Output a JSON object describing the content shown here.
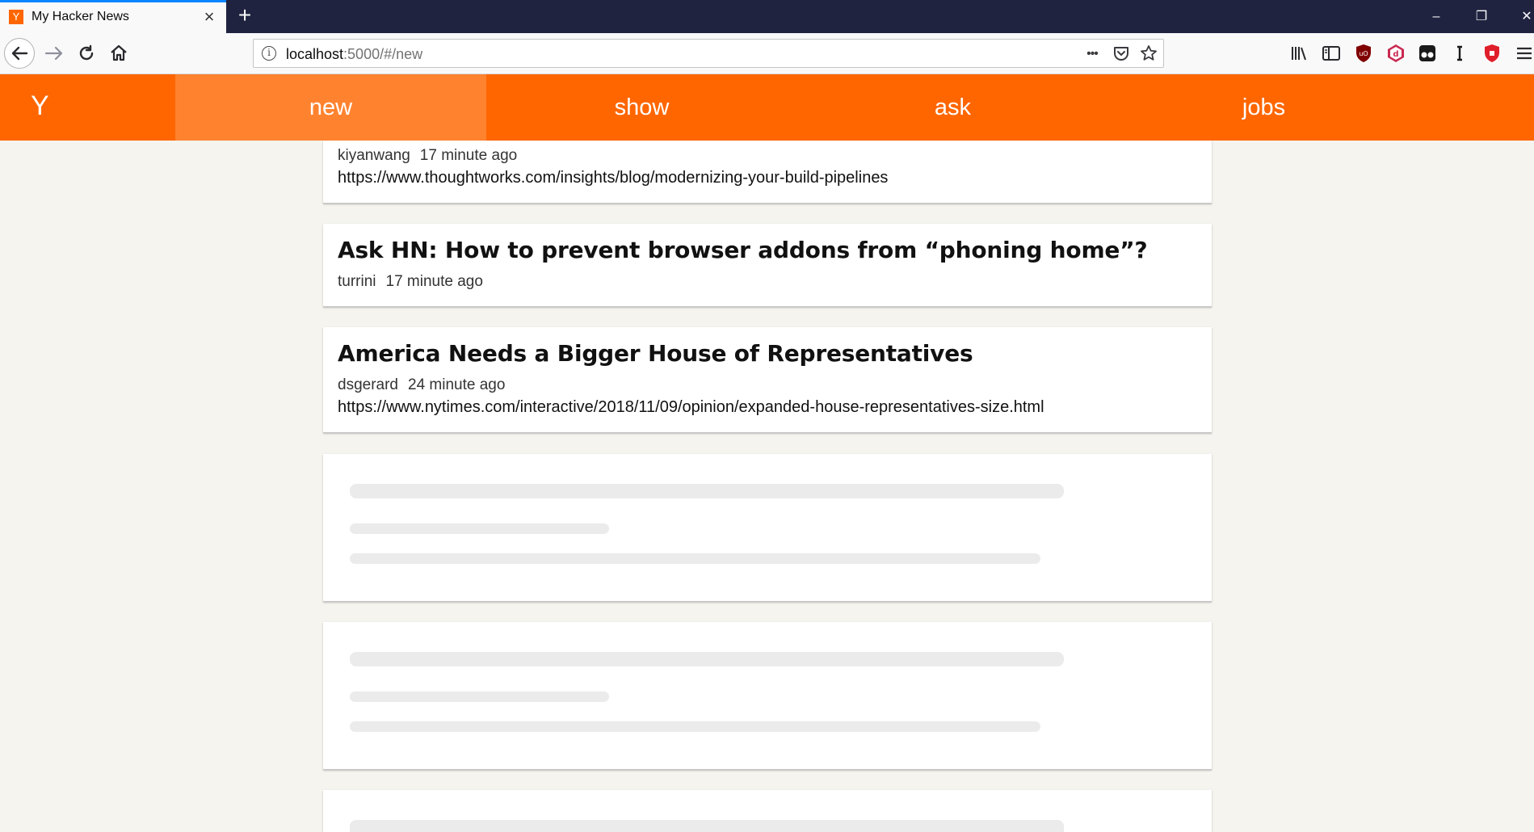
{
  "browser": {
    "tab_title": "My Hacker News",
    "tab_favicon": "Y",
    "url_host": "localhost",
    "url_rest": ":5000/#/new",
    "url_more": "•••"
  },
  "app": {
    "logo": "Y",
    "nav": [
      {
        "label": "new",
        "active": true
      },
      {
        "label": "show",
        "active": false
      },
      {
        "label": "ask",
        "active": false
      },
      {
        "label": "jobs",
        "active": false
      }
    ]
  },
  "stories": [
    {
      "title": "",
      "author": "kiyanwang",
      "time": "17 minute ago",
      "url": "https://www.thoughtworks.com/insights/blog/modernizing-your-build-pipelines"
    },
    {
      "title": "Ask HN: How to prevent browser addons from “phoning home”?",
      "author": "turrini",
      "time": "17 minute ago",
      "url": ""
    },
    {
      "title": "America Needs a Bigger House of Representatives",
      "author": "dsgerard",
      "time": "24 minute ago",
      "url": "https://www.nytimes.com/interactive/2018/11/09/opinion/expanded-house-representatives-size.html"
    }
  ],
  "colors": {
    "accent": "#ff6600",
    "active_nav": "#ff832f",
    "background": "#f5f4ef",
    "skeleton": "#ebebeb"
  }
}
